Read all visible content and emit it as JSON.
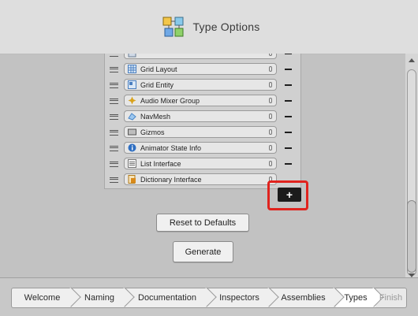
{
  "header": {
    "title": "Type Options",
    "icon": "type-blocks-icon"
  },
  "list": {
    "items": [
      {
        "label": "",
        "icon": "component-icon"
      },
      {
        "label": "Grid Layout",
        "icon": "grid-layout-icon",
        "icon_color": "#4a7fc0"
      },
      {
        "label": "Grid Entity",
        "icon": "grid-entity-icon",
        "icon_color": "#4a7fc0"
      },
      {
        "label": "Audio Mixer Group",
        "icon": "audio-mixer-icon",
        "icon_color": "#d9a21b"
      },
      {
        "label": "NavMesh",
        "icon": "navmesh-icon",
        "icon_color": "#4a86c8"
      },
      {
        "label": "Gizmos",
        "icon": "gizmos-icon",
        "icon_color": "#555555"
      },
      {
        "label": "Animator State Info",
        "icon": "info-icon",
        "icon_color": "#2f6fc2"
      },
      {
        "label": "List Interface",
        "icon": "list-icon",
        "icon_color": "#777777"
      },
      {
        "label": "Dictionary Interface",
        "icon": "dictionary-icon",
        "icon_color": "#d98a1b"
      }
    ],
    "remove_symbol": "−",
    "add_symbol": "+"
  },
  "buttons": {
    "reset_label": "Reset to Defaults",
    "generate_label": "Generate"
  },
  "breadcrumbs": {
    "steps": [
      "Welcome",
      "Naming",
      "Documentation",
      "Inspectors",
      "Assemblies",
      "Types",
      "Finish"
    ],
    "current": "Types"
  },
  "colors": {
    "highlight": "#e0231e",
    "add_button": "#1b1b1b"
  }
}
